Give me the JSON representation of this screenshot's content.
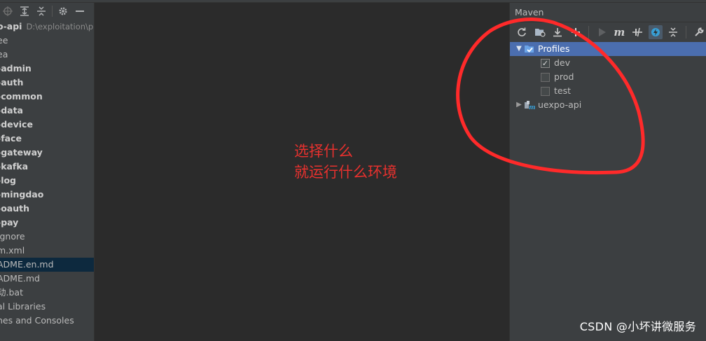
{
  "project_panel": {
    "root_name": "o-api",
    "root_path": "D:\\exploitation\\pr",
    "items": [
      {
        "label": "ee",
        "bold": false
      },
      {
        "label": "ea",
        "bold": false
      },
      {
        "label": "-admin",
        "bold": true
      },
      {
        "label": "-auth",
        "bold": true
      },
      {
        "label": "-common",
        "bold": true
      },
      {
        "label": "-data",
        "bold": true
      },
      {
        "label": "-device",
        "bold": true
      },
      {
        "label": "-face",
        "bold": true
      },
      {
        "label": "-gateway",
        "bold": true
      },
      {
        "label": "-kafka",
        "bold": true
      },
      {
        "label": "-log",
        "bold": true
      },
      {
        "label": "-mingdao",
        "bold": true
      },
      {
        "label": "-oauth",
        "bold": true
      },
      {
        "label": "-pay",
        "bold": true
      },
      {
        "label": "ignore",
        "bold": false
      },
      {
        "label": "m.xml",
        "bold": false
      },
      {
        "label": "ADME.en.md",
        "bold": false,
        "selected": true
      },
      {
        "label": "ADME.md",
        "bold": false
      },
      {
        "label": "动.bat",
        "bold": false
      },
      {
        "label": "al Libraries",
        "bold": false
      },
      {
        "label": "hes and Consoles",
        "bold": false
      }
    ]
  },
  "editor": {
    "annotation_line1": "选择什么",
    "annotation_line2": "就运行什么环境",
    "annotation_color": "#e8312e"
  },
  "maven": {
    "title": "Maven",
    "profiles_label": "Profiles",
    "profiles": [
      {
        "name": "dev",
        "checked": true
      },
      {
        "name": "prod",
        "checked": false
      },
      {
        "name": "test",
        "checked": false
      }
    ],
    "project_name": "uexpo-api",
    "accent": "#4b6eaf"
  },
  "watermark": "CSDN @小坏讲微服务"
}
